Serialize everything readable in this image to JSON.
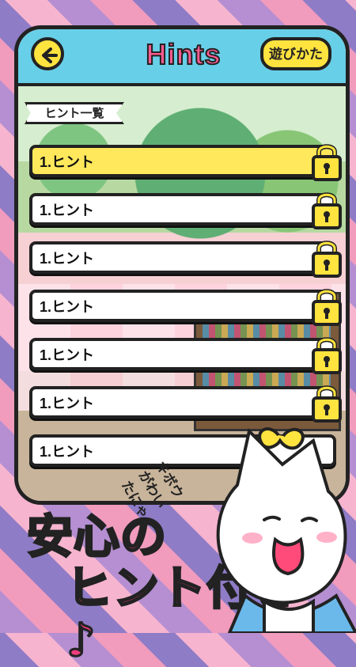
{
  "header": {
    "title": "Hints",
    "how_to_label": "遊びかた"
  },
  "section": {
    "label": "ヒント一覧"
  },
  "hints": [
    {
      "label": "1.ヒント",
      "selected": true
    },
    {
      "label": "1.ヒント",
      "selected": false
    },
    {
      "label": "1.ヒント",
      "selected": false
    },
    {
      "label": "1.ヒント",
      "selected": false
    },
    {
      "label": "1.ヒント",
      "selected": false
    },
    {
      "label": "1.ヒント",
      "selected": false
    },
    {
      "label": "1.ヒント",
      "selected": false
    }
  ],
  "promo": {
    "line1": "安心の",
    "line2": "ヒント付き♪",
    "bubble": "キボウがわいたにゃ"
  },
  "colors": {
    "accent": "#ffe33f",
    "title": "#ff5b91",
    "header": "#68cfe8",
    "promo": "#ef3c7d"
  },
  "icons": {
    "back": "back-arrow-icon",
    "lock": "lock-icon"
  }
}
